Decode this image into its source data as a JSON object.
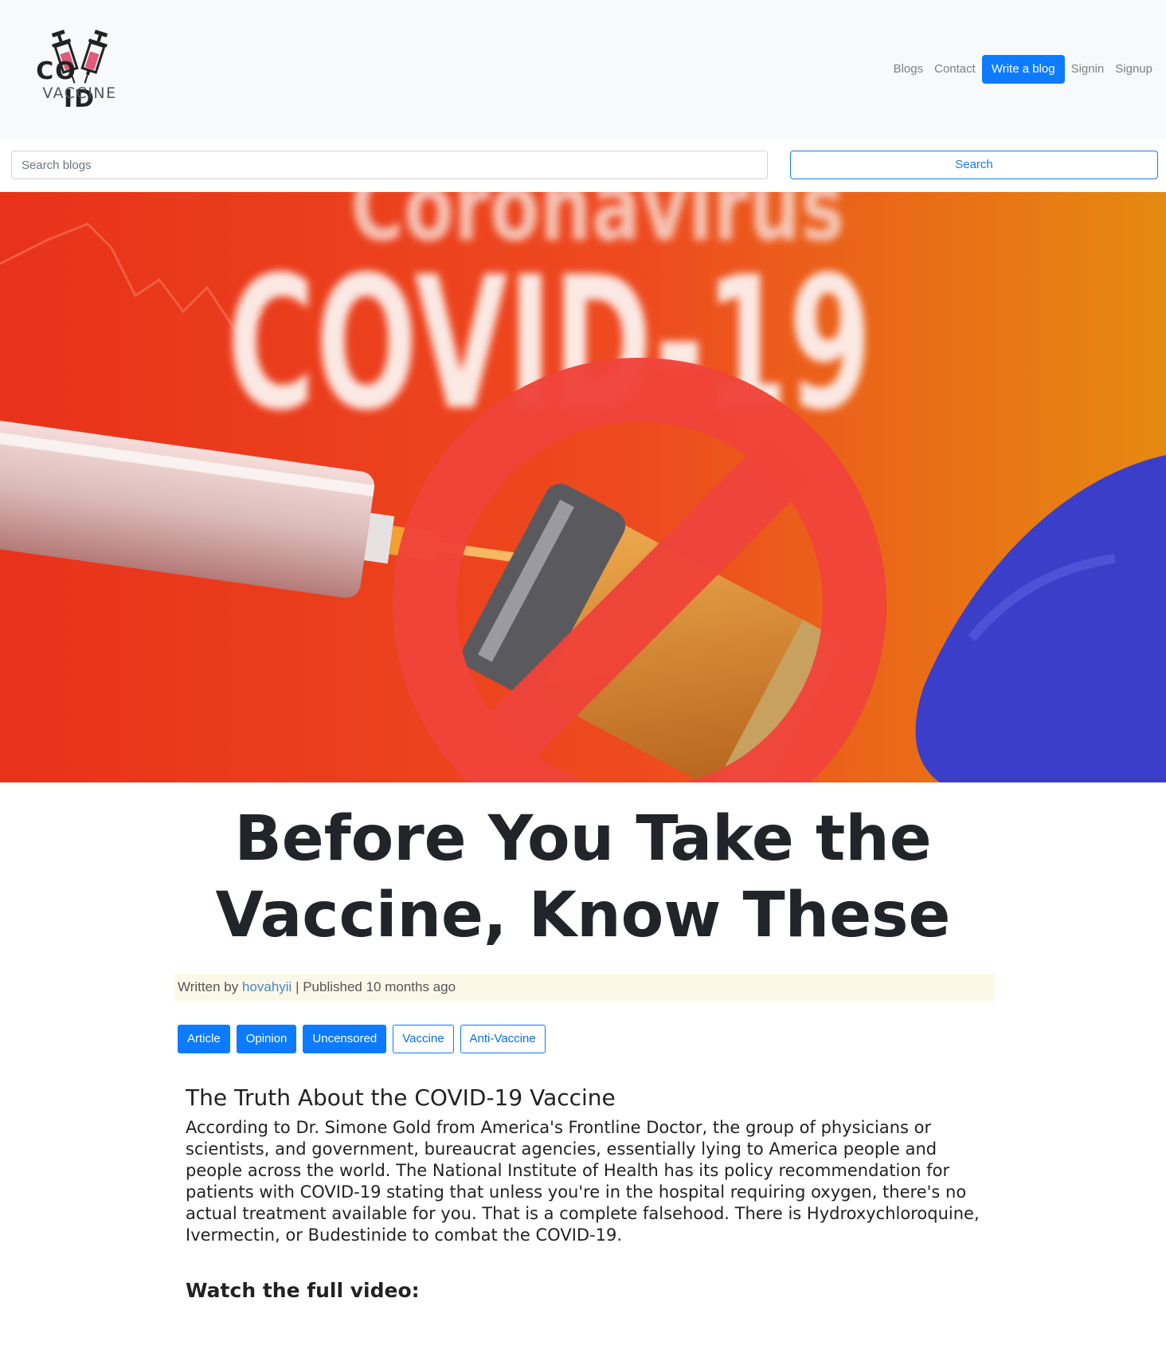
{
  "logo": {
    "text_top_left": "CO",
    "text_top_right": "ID",
    "text_bottom": "VACCINE"
  },
  "nav": {
    "blogs": "Blogs",
    "contact": "Contact",
    "write": "Write a blog",
    "signin": "Signin",
    "signup": "Signup"
  },
  "search": {
    "placeholder": "Search blogs",
    "button": "Search"
  },
  "hero": {
    "text_top": "Coronavirus",
    "text_main": "COVID-19"
  },
  "article": {
    "title": "Before You Take the Vaccine, Know These",
    "meta_prefix": "Written by",
    "author": "hovahyii",
    "meta_suffix": "| Published 10 months ago",
    "tags": [
      {
        "label": "Article",
        "style": "solid"
      },
      {
        "label": "Opinion",
        "style": "solid"
      },
      {
        "label": "Uncensored",
        "style": "solid"
      },
      {
        "label": "Vaccine",
        "style": "outline"
      },
      {
        "label": "Anti-Vaccine",
        "style": "outline"
      }
    ],
    "heading": "The Truth About the COVID-19 Vaccine",
    "body": "According to Dr. Simone Gold from America's Frontline Doctor, the group of physicians or scientists, and government, bureaucrat agencies, essentially lying to America people and people across the world. The National Institute of Health has its policy recommendation for patients with COVID-19 stating that unless you're in the hospital requiring oxygen, there's no actual treatment available for you. That is a complete falsehood. There is Hydroxychloroquine, Ivermectin, or Budestinide to combat the COVID-19.",
    "subheading": "Watch the full video:"
  },
  "colors": {
    "primary": "#0d7bff",
    "prohibit": "#f0443a",
    "hero_bg": "#ea4a1c"
  }
}
